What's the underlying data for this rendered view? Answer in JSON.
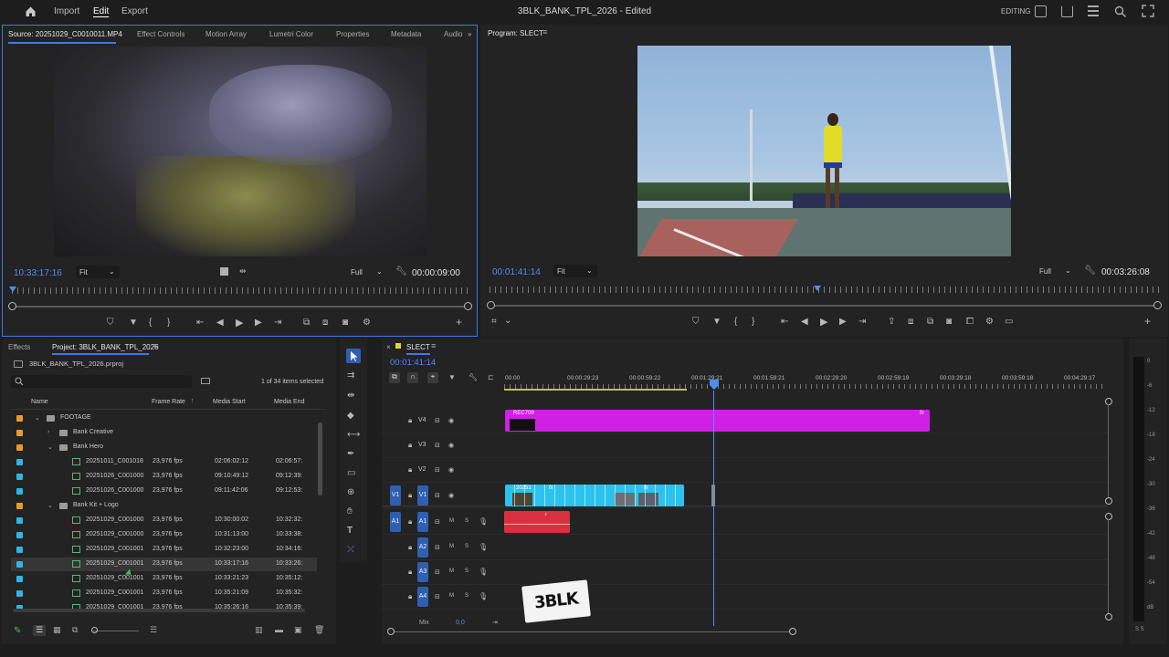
{
  "app": {
    "menu": [
      "Import",
      "Edit",
      "Export"
    ],
    "active_menu": "Edit",
    "title": "3BLK_BANK_TPL_2026 - Edited",
    "workspace": "EDITING"
  },
  "source_monitor": {
    "tabs": [
      "Source: 20251029_C0010011.MP4",
      "Effect Controls",
      "Motion Array",
      "Lumetri Color",
      "Properties",
      "Metadata",
      "Audio"
    ],
    "timecode": "10:33:17:16",
    "fit": "Fit",
    "quality": "Full",
    "duration": "00:00:09:00"
  },
  "program_monitor": {
    "tab": "Program: SLECT",
    "timecode": "00:01:41:14",
    "fit": "Fit",
    "quality": "Full",
    "duration": "00:03:26:08"
  },
  "project_panel": {
    "tabs": [
      "Effects",
      "Project: 3BLK_BANK_TPL_2026"
    ],
    "file": "3BLK_BANK_TPL_2026.prproj",
    "selection": "1 of 34 items selected",
    "columns": [
      "Name",
      "Frame Rate",
      "Media Start",
      "Media End"
    ],
    "rows": [
      {
        "name": "FOOTAGE",
        "rate": "",
        "start": "",
        "end": "",
        "kind": "bin",
        "indent": 0,
        "chip": "#e89a2b"
      },
      {
        "name": "Bank Creative",
        "rate": "",
        "start": "",
        "end": "",
        "kind": "bin",
        "indent": 1,
        "chip": "#e89a2b"
      },
      {
        "name": "Bank Hero",
        "rate": "",
        "start": "",
        "end": "",
        "kind": "bin",
        "indent": 1,
        "chip": "#e89a2b"
      },
      {
        "name": "20251011_C001018",
        "rate": "23,976 fps",
        "start": "02:06:02:12",
        "end": "02:06:57:",
        "kind": "clip",
        "indent": 2,
        "chip": "#2fb4e6"
      },
      {
        "name": "20251026_C001000",
        "rate": "23,976 fps",
        "start": "09:10:49:12",
        "end": "09:12:39:",
        "kind": "clip",
        "indent": 2,
        "chip": "#2fb4e6"
      },
      {
        "name": "20251026_C001000",
        "rate": "23,976 fps",
        "start": "09:11:42:06",
        "end": "09:12:53:",
        "kind": "clip",
        "indent": 2,
        "chip": "#2fb4e6"
      },
      {
        "name": "Bank Kit + Logo",
        "rate": "",
        "start": "",
        "end": "",
        "kind": "bin",
        "indent": 1,
        "chip": "#e89a2b"
      },
      {
        "name": "20251029_C001000",
        "rate": "23,976 fps",
        "start": "10:30:00:02",
        "end": "10:32:32:",
        "kind": "clip",
        "indent": 2,
        "chip": "#2fb4e6"
      },
      {
        "name": "20251029_C001000",
        "rate": "23,976 fps",
        "start": "10:31:13:00",
        "end": "10:33:38:",
        "kind": "clip",
        "indent": 2,
        "chip": "#2fb4e6"
      },
      {
        "name": "20251029_C001001",
        "rate": "23,976 fps",
        "start": "10:32:23:00",
        "end": "10:34:16:",
        "kind": "clip",
        "indent": 2,
        "chip": "#2fb4e6"
      },
      {
        "name": "20251029_C001001",
        "rate": "23,976 fps",
        "start": "10:33:17:16",
        "end": "10:33:26:",
        "kind": "clip",
        "indent": 2,
        "chip": "#2fb4e6"
      },
      {
        "name": "20251029_C001001",
        "rate": "23,976 fps",
        "start": "10:33:21:23",
        "end": "10:35:12:",
        "kind": "clip",
        "indent": 2,
        "chip": "#2fb4e6"
      },
      {
        "name": "20251029_C001001",
        "rate": "23,976 fps",
        "start": "10:35:21:09",
        "end": "10:35:32:",
        "kind": "clip",
        "indent": 2,
        "chip": "#2fb4e6"
      },
      {
        "name": "20251029_C001001",
        "rate": "23,976 fps",
        "start": "10:35:26:16",
        "end": "10:35:39:",
        "kind": "clip",
        "indent": 2,
        "chip": "#2fb4e6"
      }
    ]
  },
  "timeline": {
    "sequence": "SLECT",
    "timecode": "00:01:41:14",
    "ruler": [
      "00:00",
      "00:00:29:23",
      "00:00:59:22",
      "00:01:29:21",
      "00:01:59:21",
      "00:02:29:20",
      "00:02:59:19",
      "00:03:29:18",
      "00:03:59:18",
      "00:04:29:17"
    ],
    "video_tracks": [
      "V4",
      "V3",
      "V2",
      "V1"
    ],
    "audio_tracks": [
      "A1",
      "A2",
      "A3",
      "A4"
    ],
    "mix_label": "Mix",
    "mix_value": "0,0",
    "clip_v4_label": "REC709",
    "clip_v1_label": "20251",
    "fx": "fx",
    "track_m": "M",
    "track_s": "S",
    "logo": "3BLK"
  },
  "vu_meter": {
    "marks": [
      "0",
      "-6",
      "-12",
      "-18",
      "-24",
      "-30",
      "-36",
      "-42",
      "-48",
      "-54",
      "dB"
    ],
    "footer": "S S"
  },
  "colors": {
    "accent": "#3c7be3",
    "v4_clip": "#d21fe6",
    "v1_clip": "#2bc3ee",
    "a1_clip": "#d9303f"
  }
}
